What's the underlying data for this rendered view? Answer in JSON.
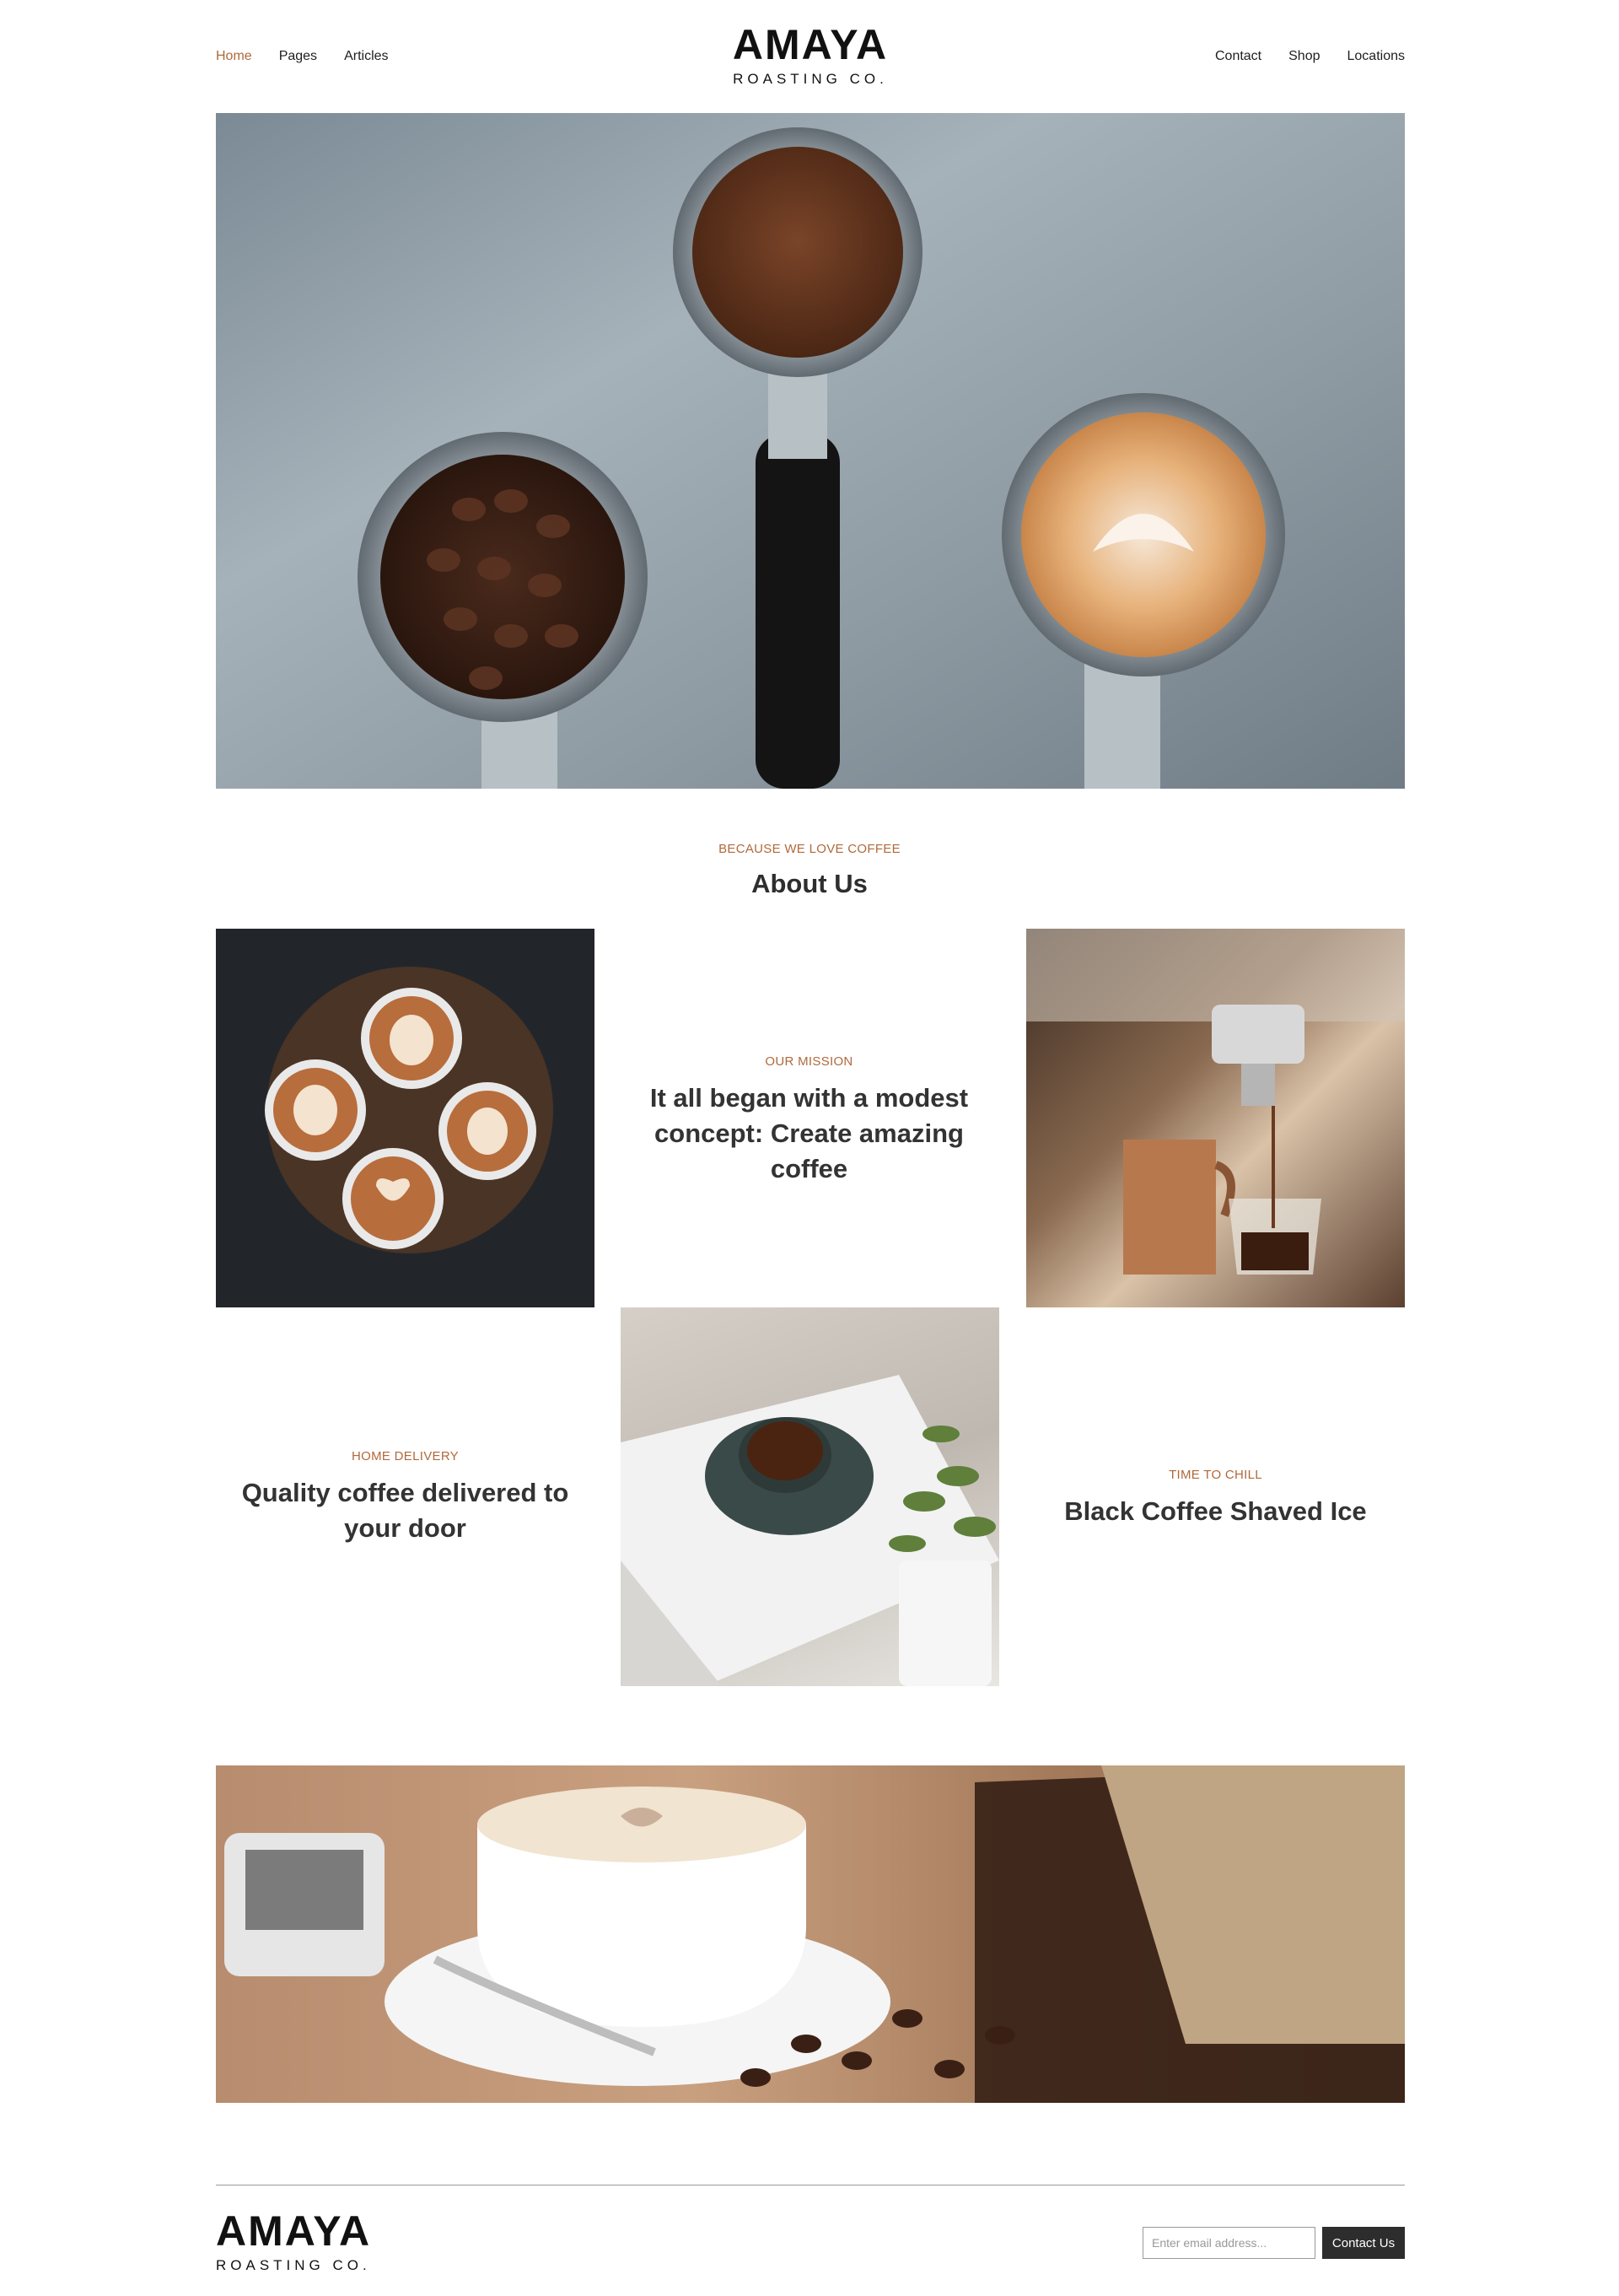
{
  "nav": {
    "left": [
      {
        "label": "Home",
        "active": true
      },
      {
        "label": "Pages",
        "active": false
      },
      {
        "label": "Articles",
        "active": false
      }
    ],
    "right": [
      {
        "label": "Contact"
      },
      {
        "label": "Shop"
      },
      {
        "label": "Locations"
      }
    ]
  },
  "logo": {
    "wordmark": "AMAYA",
    "tagline": "ROASTING CO."
  },
  "about": {
    "eyebrow": "BECAUSE WE LOVE COFFEE",
    "title": "About Us"
  },
  "tiles": {
    "mission": {
      "eyebrow": "OUR MISSION",
      "title": "It all began with a modest concept: Create amazing coffee"
    },
    "delivery": {
      "eyebrow": "HOME DELIVERY",
      "title": "Quality coffee delivered to your door"
    },
    "chill": {
      "eyebrow": "TIME TO CHILL",
      "title": "Black Coffee Shaved Ice"
    }
  },
  "footer": {
    "email_placeholder": "Enter email address...",
    "contact_button": "Contact Us"
  },
  "colors": {
    "accent": "#b0693a",
    "text": "#2e2e2e",
    "button": "#2d2d2d"
  }
}
